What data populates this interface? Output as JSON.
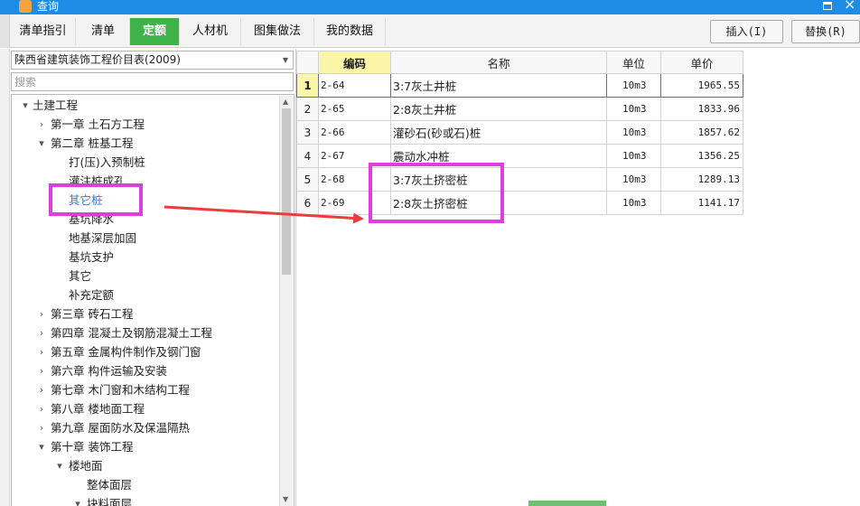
{
  "window": {
    "title": "查询"
  },
  "tabs": [
    {
      "label": "清单指引"
    },
    {
      "label": "清单"
    },
    {
      "label": "定额"
    },
    {
      "label": "人材机"
    },
    {
      "label": "图集做法"
    },
    {
      "label": "我的数据"
    }
  ],
  "active_tab": "定额",
  "buttons": {
    "insert": "插入(I)",
    "replace": "替换(R)"
  },
  "catalog": {
    "selected": "陕西省建筑装饰工程价目表(2009)"
  },
  "search": {
    "placeholder": "搜索",
    "value": ""
  },
  "tree": [
    {
      "label": "土建工程",
      "toggle": "▾"
    },
    {
      "label": "第一章  土石方工程",
      "toggle": "›"
    },
    {
      "label": "第二章  桩基工程",
      "toggle": "▾"
    },
    {
      "label": "打(压)入预制桩",
      "toggle": ""
    },
    {
      "label": "灌注桩成孔",
      "toggle": ""
    },
    {
      "label": "其它桩",
      "toggle": ""
    },
    {
      "label": "基坑降水",
      "toggle": ""
    },
    {
      "label": "地基深层加固",
      "toggle": ""
    },
    {
      "label": "基坑支护",
      "toggle": ""
    },
    {
      "label": "其它",
      "toggle": ""
    },
    {
      "label": "补充定额",
      "toggle": ""
    },
    {
      "label": "第三章  砖石工程",
      "toggle": "›"
    },
    {
      "label": "第四章  混凝土及钢筋混凝土工程",
      "toggle": "›"
    },
    {
      "label": "第五章  金属构件制作及钢门窗",
      "toggle": "›"
    },
    {
      "label": "第六章  构件运输及安装",
      "toggle": "›"
    },
    {
      "label": "第七章  木门窗和木结构工程",
      "toggle": "›"
    },
    {
      "label": "第八章  楼地面工程",
      "toggle": "›"
    },
    {
      "label": "第九章  屋面防水及保温隔热",
      "toggle": "›"
    },
    {
      "label": "第十章  装饰工程",
      "toggle": "▾"
    },
    {
      "label": "楼地面",
      "toggle": "▾"
    },
    {
      "label": "整体面层",
      "toggle": ""
    },
    {
      "label": "块料面层",
      "toggle": "▾"
    }
  ],
  "selected_tree_item": "其它桩",
  "grid": {
    "headers": {
      "code": "编码",
      "name": "名称",
      "unit": "单位",
      "price": "单价"
    },
    "rows": [
      {
        "num": "1",
        "code": "2-64",
        "name": "3:7灰土井桩",
        "unit": "10m3",
        "price": "1965.55"
      },
      {
        "num": "2",
        "code": "2-65",
        "name": "2:8灰土井桩",
        "unit": "10m3",
        "price": "1833.96"
      },
      {
        "num": "3",
        "code": "2-66",
        "name": "灌砂石(砂或石)桩",
        "unit": "10m3",
        "price": "1857.62"
      },
      {
        "num": "4",
        "code": "2-67",
        "name": "震动水冲桩",
        "unit": "10m3",
        "price": "1356.25"
      },
      {
        "num": "5",
        "code": "2-68",
        "name": "3:7灰土挤密桩",
        "unit": "10m3",
        "price": "1289.13"
      },
      {
        "num": "6",
        "code": "2-69",
        "name": "2:8灰土挤密桩",
        "unit": "10m3",
        "price": "1141.17"
      }
    ]
  },
  "colors": {
    "title_bar": "#1e8ce6",
    "active_tab": "#3fb24a",
    "highlight_header": "#fbf5a9",
    "annotation": "#e03de0",
    "arrow": "#ee3b3b",
    "selected_text": "#2f7be5"
  },
  "icons": {
    "app": "app-logo-icon",
    "maximize": "maximize-icon",
    "close": "close-icon"
  }
}
